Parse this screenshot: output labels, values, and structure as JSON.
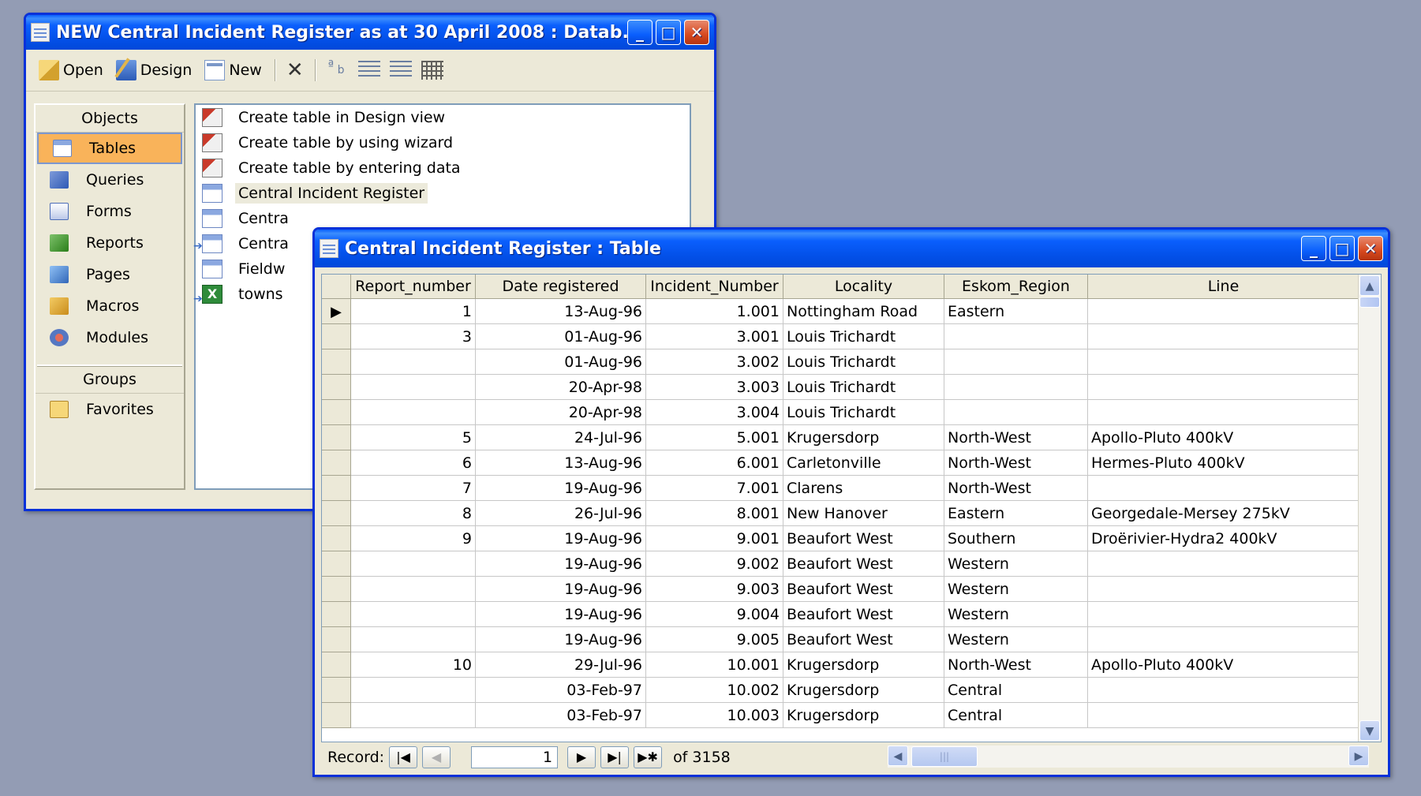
{
  "db_window": {
    "title": "NEW Central Incident Register as at 30 April 2008 : Datab...",
    "toolbar": {
      "open_label": "Open",
      "design_label": "Design",
      "new_label": "New",
      "delete_glyph": "✕"
    },
    "objects": {
      "header": "Objects",
      "items": [
        "Tables",
        "Queries",
        "Forms",
        "Reports",
        "Pages",
        "Macros",
        "Modules"
      ],
      "selected": "Tables",
      "groups_header": "Groups",
      "groups": [
        "Favorites"
      ]
    },
    "list": [
      "Create table in Design view",
      "Create table by using wizard",
      "Create table by entering data",
      "Central Incident Register",
      "Centra",
      "Centra",
      "Fieldw",
      "towns"
    ]
  },
  "table_window": {
    "title": "Central Incident Register : Table",
    "columns": [
      "Report_number",
      "Date registered",
      "Incident_Number",
      "Locality",
      "Eskom_Region",
      "Line"
    ],
    "rows": [
      [
        "1",
        "13-Aug-96",
        "1.001",
        "Nottingham Road",
        "Eastern",
        ""
      ],
      [
        "3",
        "01-Aug-96",
        "3.001",
        "Louis Trichardt",
        "",
        ""
      ],
      [
        "",
        "01-Aug-96",
        "3.002",
        "Louis Trichardt",
        "",
        ""
      ],
      [
        "",
        "20-Apr-98",
        "3.003",
        "Louis Trichardt",
        "",
        ""
      ],
      [
        "",
        "20-Apr-98",
        "3.004",
        "Louis Trichardt",
        "",
        ""
      ],
      [
        "5",
        "24-Jul-96",
        "5.001",
        "Krugersdorp",
        "North-West",
        "Apollo-Pluto 400kV"
      ],
      [
        "6",
        "13-Aug-96",
        "6.001",
        "Carletonville",
        "North-West",
        "Hermes-Pluto 400kV"
      ],
      [
        "7",
        "19-Aug-96",
        "7.001",
        "Clarens",
        "North-West",
        ""
      ],
      [
        "8",
        "26-Jul-96",
        "8.001",
        "New Hanover",
        "Eastern",
        "Georgedale-Mersey 275kV"
      ],
      [
        "9",
        "19-Aug-96",
        "9.001",
        "Beaufort West",
        "Southern",
        "Droërivier-Hydra2 400kV"
      ],
      [
        "",
        "19-Aug-96",
        "9.002",
        "Beaufort West",
        "Western",
        ""
      ],
      [
        "",
        "19-Aug-96",
        "9.003",
        "Beaufort West",
        "Western",
        ""
      ],
      [
        "",
        "19-Aug-96",
        "9.004",
        "Beaufort West",
        "Western",
        ""
      ],
      [
        "",
        "19-Aug-96",
        "9.005",
        "Beaufort West",
        "Western",
        ""
      ],
      [
        "10",
        "29-Jul-96",
        "10.001",
        "Krugersdorp",
        "North-West",
        "Apollo-Pluto 400kV"
      ],
      [
        "",
        "03-Feb-97",
        "10.002",
        "Krugersdorp",
        "Central",
        ""
      ],
      [
        "",
        "03-Feb-97",
        "10.003",
        "Krugersdorp",
        "Central",
        ""
      ]
    ],
    "nav": {
      "record_label": "Record:",
      "current": "1",
      "of_label": "of",
      "total": "3158"
    }
  }
}
